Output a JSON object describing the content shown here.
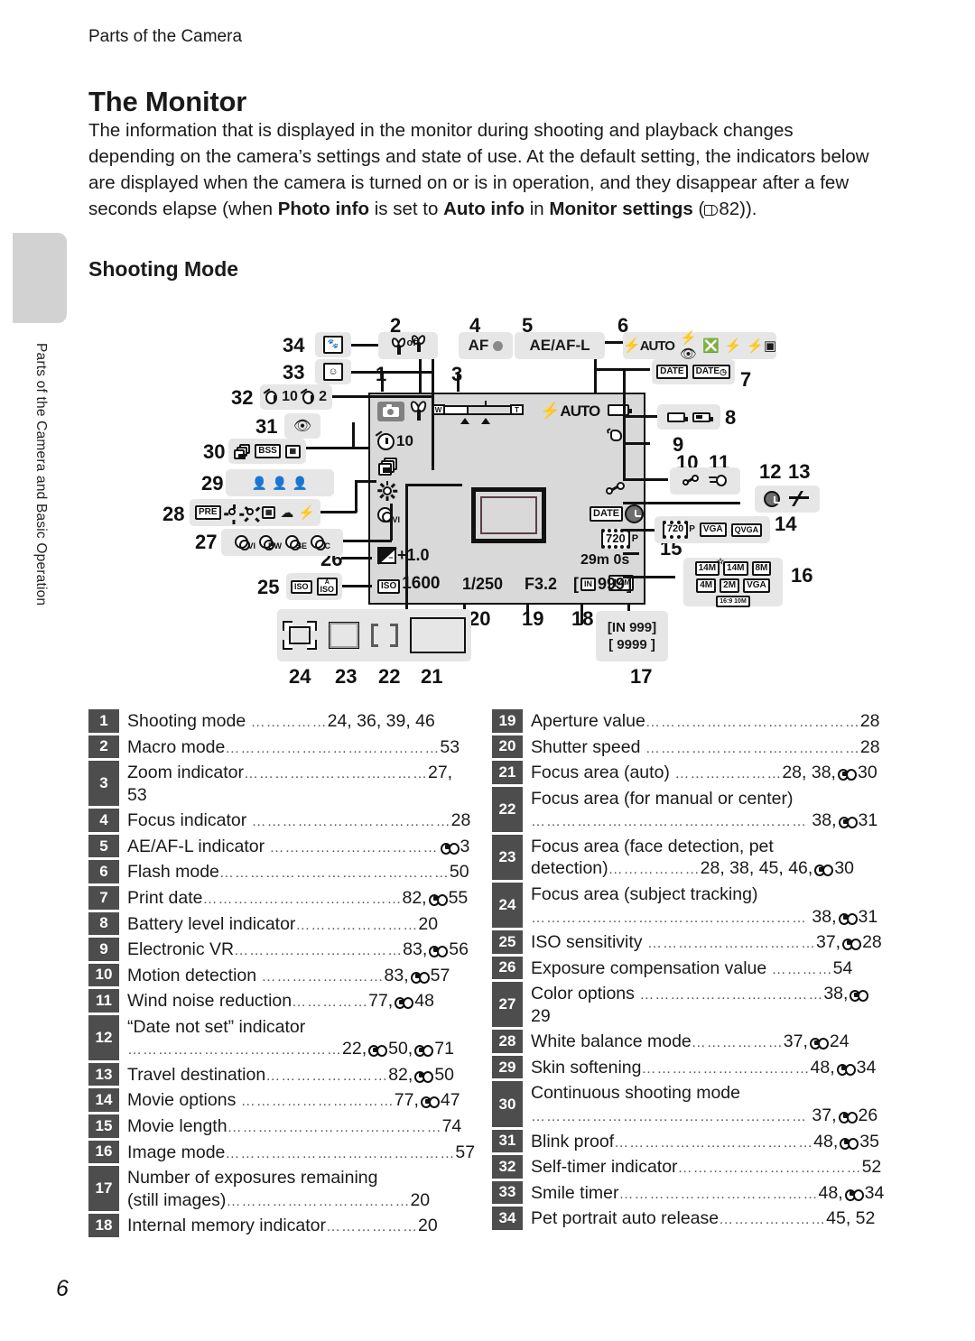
{
  "running_head": "Parts of the Camera",
  "side_tab_label": "Parts of the Camera and Basic Operation",
  "page_number": "6",
  "title": "The Monitor",
  "intro_parts": {
    "p1": "The information that is displayed in the monitor during shooting and playback changes depending on the camera’s settings and state of use. At the default setting, the indicators below are displayed when the camera is turned on or is in operation, and they disappear after a few seconds elapse (when ",
    "b1": "Photo info",
    "p2": " is set to ",
    "b2": "Auto info",
    "p3": " in ",
    "b3": "Monitor settings",
    "p4": " (",
    "p5": "82))."
  },
  "subtitle": "Shooting Mode",
  "diagram": {
    "callout_numbers": [
      "1",
      "2",
      "3",
      "4",
      "5",
      "6",
      "7",
      "8",
      "9",
      "10",
      "11",
      "12",
      "13",
      "14",
      "15",
      "16",
      "17",
      "18",
      "19",
      "20",
      "21",
      "22",
      "23",
      "24",
      "25",
      "26",
      "27",
      "28",
      "29",
      "30",
      "31",
      "32",
      "33",
      "34"
    ],
    "monitor_values": {
      "self_timer": "10",
      "flash": "AUTO",
      "exposure_comp": "+1.0",
      "iso_label": "ISO",
      "iso_value": "1600",
      "shutter_speed": "1/250",
      "aperture": "F3.2",
      "remaining": "999",
      "internal_memory": "IN",
      "movie_option": "720",
      "movie_option_suffix": "P",
      "movie_length": "29m 0s",
      "image_mode": "14",
      "image_mode_unit": "M",
      "date_label": "DATE",
      "zoom_w": "W",
      "zoom_t": "T"
    },
    "callout_chips": {
      "c2_macro_off": "off",
      "c4_af": "AF",
      "c5_aeafl": "AE/AF-L",
      "c6_flash": [
        "AUTO"
      ],
      "c7_date": [
        "DATE",
        "DATE"
      ],
      "c14_movie": [
        "720",
        "P",
        "VGA",
        "QVGA"
      ],
      "c16_image_mode": [
        "14M",
        "14M",
        "8M",
        "4M",
        "2M",
        "VGA",
        "16:9 10M"
      ],
      "c17_remaining": [
        "[IN 999]",
        "[ 9999 ]"
      ],
      "c25_iso": [
        "ISO",
        "ISO"
      ],
      "c26_exp": "+1.0",
      "c27_color": [
        "VI",
        "BW",
        "SE",
        "C"
      ],
      "c28_wb": [
        "PRE"
      ],
      "c30_cont": [
        "BSS"
      ],
      "c32_timer": [
        "10",
        "2"
      ]
    }
  },
  "legend_left": [
    {
      "n": "1",
      "label": "Shooting mode",
      "dots": "……………",
      "pages": "24, 36, 39, 46",
      "ref": null
    },
    {
      "n": "2",
      "label": "Macro mode",
      "dots": "……………………………………",
      "pages": "53",
      "ref": null
    },
    {
      "n": "3",
      "label": "Zoom indicator",
      "dots": "………………………………",
      "pages": "27, 53",
      "ref": null
    },
    {
      "n": "4",
      "label": "Focus indicator",
      "dots": "…………………………………",
      "pages": "28",
      "ref": null
    },
    {
      "n": "5",
      "label": "AE/AF-L indicator",
      "dots": "……………………………",
      "pages": "3",
      "ref": "E"
    },
    {
      "n": "6",
      "label": "Flash mode",
      "dots": "………………………………………",
      "pages": "50",
      "ref": null
    },
    {
      "n": "7",
      "label": "Print date",
      "dots": "…………………………………",
      "pages": "82,",
      "ref": "E",
      "pages2": "55"
    },
    {
      "n": "8",
      "label": "Battery level indicator",
      "dots": "……………………",
      "pages": "20",
      "ref": null
    },
    {
      "n": "9",
      "label": "Electronic VR",
      "dots": "……………………………",
      "pages": "83,",
      "ref": "E",
      "pages2": "56"
    },
    {
      "n": "10",
      "label": "Motion detection",
      "dots": "……………………",
      "pages": "83,",
      "ref": "E",
      "pages2": "57"
    },
    {
      "n": "11",
      "label": "Wind noise reduction",
      "dots": "……………",
      "pages": "77,",
      "ref": "E",
      "pages2": "48"
    },
    {
      "n": "12",
      "label": "“Date not set” indicator",
      "line2_dots": "……………………………………",
      "pages": "22,",
      "ref": "E",
      "pages2": "50,",
      "ref2": "E",
      "pages3": "71",
      "twoline": true
    },
    {
      "n": "13",
      "label": "Travel destination",
      "dots": "……………………",
      "pages": "82,",
      "ref": "E",
      "pages2": "50"
    },
    {
      "n": "14",
      "label": "Movie options",
      "dots": "…………………………",
      "pages": "77,",
      "ref": "E",
      "pages2": "47"
    },
    {
      "n": "15",
      "label": "Movie length",
      "dots": "……………………………………",
      "pages": "74",
      "ref": null
    },
    {
      "n": "16",
      "label": "Image mode",
      "dots": "………………………………………",
      "pages": "57",
      "ref": null
    },
    {
      "n": "17",
      "label": "Number of exposures remaining",
      "line2": "(still images)",
      "line2_dots": "………………………………",
      "pages": "20",
      "ref": null,
      "twoline": true
    },
    {
      "n": "18",
      "label": "Internal memory indicator",
      "dots": "………………",
      "pages": "20",
      "ref": null
    }
  ],
  "legend_right": [
    {
      "n": "19",
      "label": "Aperture value",
      "dots": "……………………………………",
      "pages": "28",
      "ref": null
    },
    {
      "n": "20",
      "label": "Shutter speed",
      "dots": "……………………………………",
      "pages": "28",
      "ref": null
    },
    {
      "n": "21",
      "label": "Focus area (auto)",
      "dots": "…………………",
      "pages": "28, 38,",
      "ref": "E",
      "pages2": "30"
    },
    {
      "n": "22",
      "label": "Focus area (for manual or center)",
      "line2_dots": "………………………………………………",
      "pages": "38,",
      "ref": "E",
      "pages2": "31",
      "twoline": true
    },
    {
      "n": "23",
      "label": "Focus area (face detection, pet",
      "line2": "detection)",
      "line2_dots": "………………",
      "pages": "28, 38, 45, 46,",
      "ref": "E",
      "pages2": "30",
      "twoline": true
    },
    {
      "n": "24",
      "label": "Focus area (subject tracking)",
      "line2_dots": "………………………………………………",
      "pages": "38,",
      "ref": "E",
      "pages2": "31",
      "twoline": true
    },
    {
      "n": "25",
      "label": "ISO sensitivity",
      "dots": "……………………………",
      "pages": "37,",
      "ref": "E",
      "pages2": "28"
    },
    {
      "n": "26",
      "label": "Exposure compensation value",
      "dots": "…………",
      "pages": "54",
      "ref": null
    },
    {
      "n": "27",
      "label": "Color options",
      "dots": "………………………………",
      "pages": "38,",
      "ref": "E",
      "pages2": "29"
    },
    {
      "n": "28",
      "label": "White balance mode",
      "dots": "………………",
      "pages": "37,",
      "ref": "E",
      "pages2": "24"
    },
    {
      "n": "29",
      "label": "Skin softening",
      "dots": "……………………………",
      "pages": "48,",
      "ref": "E",
      "pages2": "34"
    },
    {
      "n": "30",
      "label": "Continuous shooting mode",
      "line2_dots": "………………………………………………",
      "pages": "37,",
      "ref": "E",
      "pages2": "26",
      "twoline": true
    },
    {
      "n": "31",
      "label": "Blink proof",
      "dots": "…………………………………",
      "pages": "48,",
      "ref": "E",
      "pages2": "35"
    },
    {
      "n": "32",
      "label": "Self-timer indicator",
      "dots": "………………………………",
      "pages": "52",
      "ref": null
    },
    {
      "n": "33",
      "label": "Smile timer",
      "dots": "…………………………………",
      "pages": "48,",
      "ref": "E",
      "pages2": "34"
    },
    {
      "n": "34",
      "label": "Pet portrait auto release",
      "dots": "…………………",
      "pages": "45, 52",
      "ref": null
    }
  ],
  "colors": {
    "monitor_bg": "#d9d9d9",
    "chip_bg": "#e6e6e6",
    "num_badge_bg": "#4d4d4d",
    "side_tab": "#d2d2d2"
  }
}
